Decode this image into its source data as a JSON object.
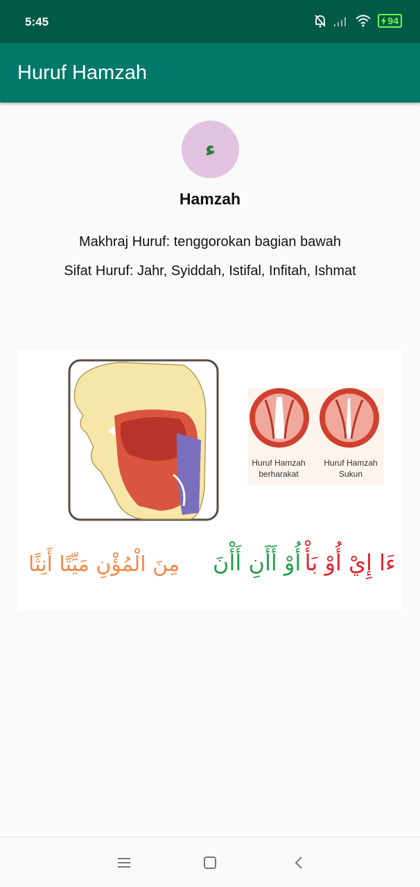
{
  "status_bar": {
    "time": "5:45",
    "battery": "94",
    "icons": [
      "bell-off-icon",
      "signal-icon",
      "wifi-icon",
      "battery-charging-icon"
    ]
  },
  "app_bar": {
    "title": "Huruf Hamzah"
  },
  "letter": {
    "glyph": "ء",
    "name": "Hamzah",
    "makhraj": "Makhraj Huruf: tenggorokan bagian bawah",
    "sifat": "Sifat Huruf: Jahr, Syiddah, Istifal, Infitah, Ishmat"
  },
  "illustration": {
    "caption_left_1": "Huruf Hamzah",
    "caption_left_2": "berharakat",
    "caption_right_1": "Huruf Hamzah",
    "caption_right_2": "Sukun",
    "arabic_red": "ءَا إِيْ أُوْ بَأْ",
    "arabic_green": "أُوْ أَأَنِ أَأْنَ",
    "arabic_orange": "مِنَ الْمُؤْنِ مَيِّتًا أَنِثًا"
  },
  "nav_bar": {
    "icons": [
      "menu-icon",
      "home-square-icon",
      "back-chevron-icon"
    ]
  },
  "colors": {
    "status_bar": "#005a46",
    "app_bar": "#00796b",
    "circle": "#e2c3df",
    "glyph": "#2e7d32"
  }
}
